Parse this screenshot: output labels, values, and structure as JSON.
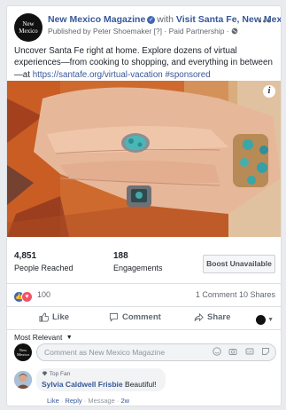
{
  "post": {
    "page_name": "New Mexico Magazine",
    "with_text": "with",
    "location": "Visit Santa Fe, New Mexico.",
    "published_by": "Published by Peter Shoemaker",
    "tag": "[?]",
    "paid": "· Paid Partnership ·",
    "logo_text_1": "New",
    "logo_text_2": "Mexico",
    "caption": "Uncover Santa Fe right at home. Explore dozens of virtual experiences—from cooking to shopping, and everything in between—at",
    "link": "https://santafe.org/virtual-vacation",
    "hashtag": "#sponsored",
    "info_label": "i"
  },
  "stats": {
    "reach_value": "4,851",
    "reach_label": "People Reached",
    "engage_value": "188",
    "engage_label": "Engagements",
    "boost_label": "Boost Unavailable"
  },
  "reactions": {
    "count": "100",
    "comments": "1 Comment",
    "shares": "10 Shares"
  },
  "actions": {
    "like": "Like",
    "comment": "Comment",
    "share": "Share"
  },
  "comments": {
    "sort_label": "Most Relevant",
    "input_placeholder": "Comment as New Mexico Magazine",
    "items": [
      {
        "badge": "Top Fan",
        "author": "Sylvia Caldwell Frisbie",
        "text": "Beautiful!",
        "like": "Like",
        "reply": "Reply",
        "message": "Message",
        "time": "2w"
      }
    ]
  },
  "colors": {
    "link": "#365899",
    "like_blue": "#4267b2",
    "love_red": "#f25268"
  }
}
